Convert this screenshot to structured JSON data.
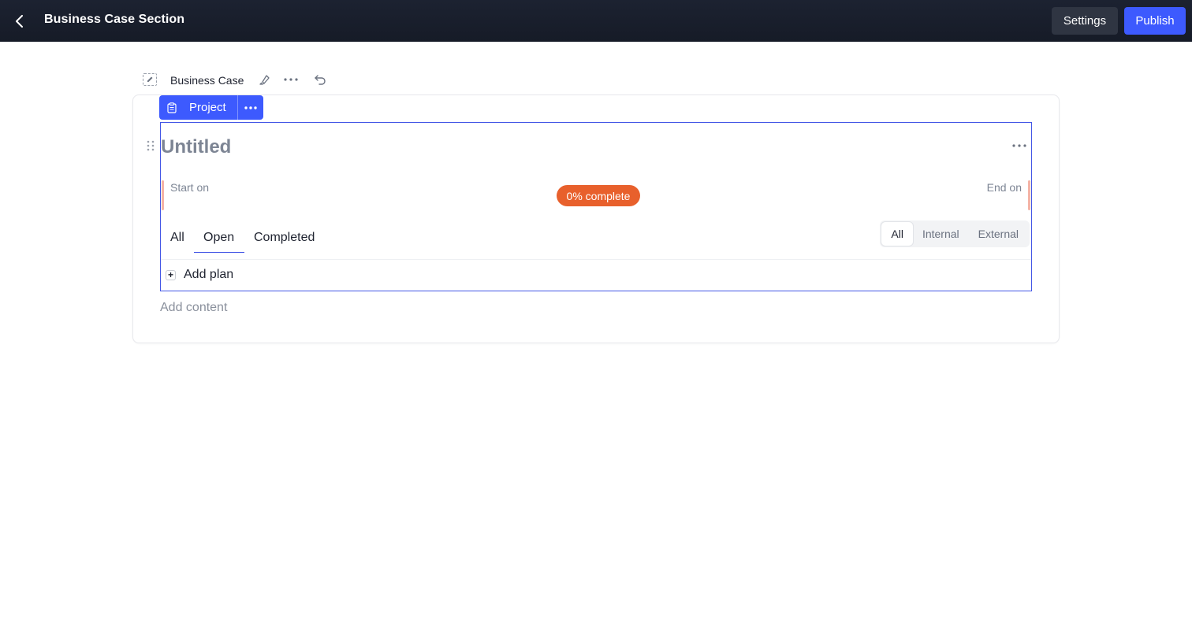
{
  "header": {
    "title": "Business Case Section",
    "settings_label": "Settings",
    "publish_label": "Publish",
    "colors": {
      "bar": "#1c2231",
      "publish": "#3d5afe",
      "settings": "#2f3542"
    }
  },
  "section": {
    "name": "Business Case",
    "icons": [
      "edit-icon",
      "highlighter-icon",
      "more-icon",
      "undo-icon"
    ]
  },
  "block_toolbar": {
    "label": "Project",
    "icons": [
      "clipboard-icon",
      "more-icon"
    ]
  },
  "project_block": {
    "title": "Untitled",
    "start_label": "Start on",
    "end_label": "End on",
    "progress_label": "0% complete",
    "progress_fraction": 0,
    "tabs": [
      "All",
      "Open",
      "Completed"
    ],
    "active_tab": "Open",
    "filter_options": [
      "All",
      "Internal",
      "External"
    ],
    "active_filter": "All",
    "add_plan_label": "Add plan",
    "colors": {
      "border": "#4356e6",
      "progress": "#e8602c",
      "timeline": "#f4b3a6"
    }
  },
  "add_content_placeholder": "Add content"
}
